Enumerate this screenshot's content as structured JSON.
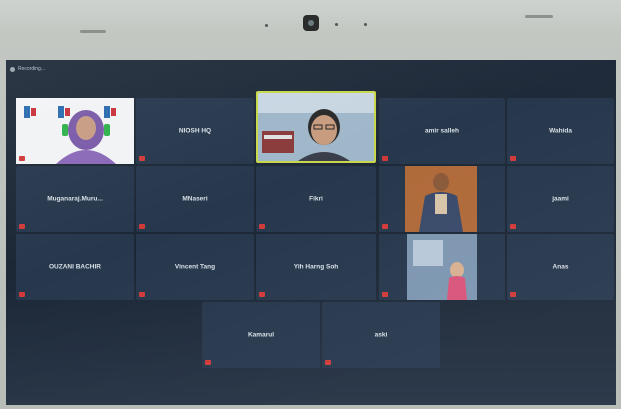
{
  "status": {
    "text": "Recording..."
  },
  "tiles": {
    "niosh_hq": "NIOSH HQ",
    "amir_salleh": "amir salleh",
    "wahida": "Wahida",
    "muganaraj": "Muganaraj.Muru...",
    "mnaseri": "MNaseri",
    "fikri": "Fikri",
    "jaami": "jaami",
    "ouzani": "OUZANI BACHIR",
    "vincent": "Vincent Tang",
    "yih": "Yih Harng Soh",
    "anas": "Anas",
    "kamarul": "Kamarul",
    "aski": "aski"
  },
  "colors": {
    "accent": "#c8d84a",
    "tile_bg": "#27384d",
    "mic_muted": "#d23a3a"
  }
}
